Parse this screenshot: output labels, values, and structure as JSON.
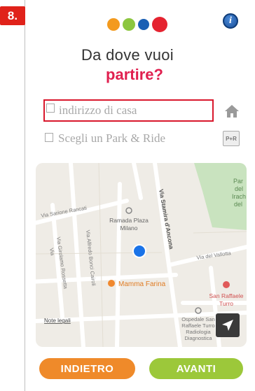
{
  "step": {
    "number": "8."
  },
  "dots": [
    "#f39a1e",
    "#8cc63f",
    "#1a5fb4",
    "#e52330"
  ],
  "header": {
    "title_line1": "Da dove vuoi",
    "title_line2": "partire?"
  },
  "form": {
    "home_placeholder": "indirizzo di casa",
    "park_ride_label": "Scegli un Park & Ride",
    "park_ride_icon_text": "P+R"
  },
  "map": {
    "park_label": [
      "Par",
      "del",
      "Irach",
      "del"
    ],
    "streets": {
      "largo_rancati": "Via Sarione Rancati",
      "stamira": "Via Stamira d'Ancona",
      "vallotta": "Via del Vallotta",
      "bonci": "Via Alfredo Bonci Cairoli",
      "rossetta": "Via Girolamo Rossetta",
      "vii": "Via"
    },
    "pois": {
      "hotel": [
        "Ramada Plaza",
        "Milano"
      ],
      "restaurant": "Mamma Farina",
      "hospital1": [
        "San Raffaele",
        "Turro"
      ],
      "hospital2": [
        "Ospedale San",
        "Raffaele Turro",
        "Radiologia",
        "Diagnostica"
      ]
    },
    "legal": "Note legali"
  },
  "buttons": {
    "back": "INDIETRO",
    "next": "AVANTI"
  },
  "colors": {
    "accent_red": "#e0204f",
    "back_button": "#ef8a2a",
    "next_button": "#9cc83a",
    "highlight_box": "#d9172c"
  }
}
